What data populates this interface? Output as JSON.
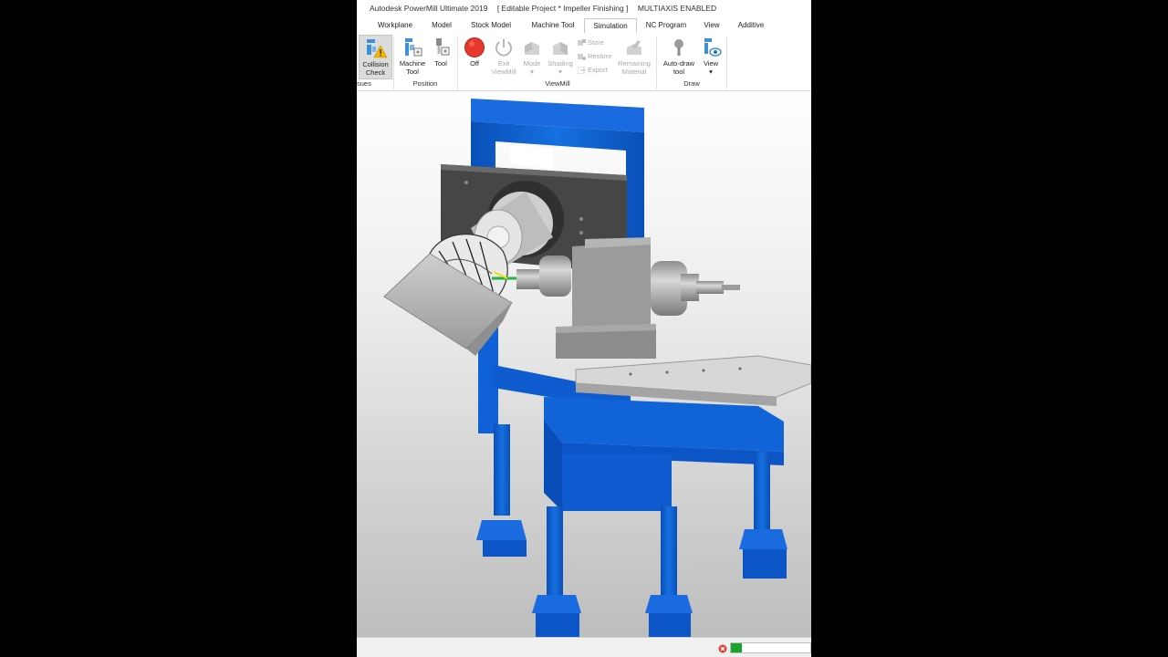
{
  "window": {
    "app_title": "Autodesk PowerMill Ultimate 2019",
    "project": "[ Editable Project * Impeller Finishing ]",
    "mode": "MULTIAXIS ENABLED"
  },
  "tabs": [
    {
      "label": "Workplane"
    },
    {
      "label": "Model"
    },
    {
      "label": "Stock Model"
    },
    {
      "label": "Machine Tool"
    },
    {
      "label": "Simulation"
    },
    {
      "label": "NC Program"
    },
    {
      "label": "View"
    },
    {
      "label": "Additive"
    }
  ],
  "active_tab": "Simulation",
  "ribbon": {
    "issues": {
      "label": "sues",
      "collision_check": {
        "line1": "Collision",
        "line2": "Check"
      }
    },
    "position": {
      "label": "Position",
      "machine_tool": {
        "line1": "Machine",
        "line2": "Tool"
      },
      "tool": {
        "line1": "Tool"
      }
    },
    "viewmill": {
      "label": "ViewMill",
      "off": {
        "line1": "Off"
      },
      "exit_viewmill": {
        "line1": "Exit",
        "line2": "ViewMill"
      },
      "mode": {
        "line1": "Mode",
        "arrow": "▾"
      },
      "shading": {
        "line1": "Shading",
        "arrow": "▾"
      },
      "store": "Store",
      "restore": "Restore",
      "export": "Export",
      "remaining_material": {
        "line1": "Remaining",
        "line2": "Material"
      }
    },
    "draw": {
      "label": "Draw",
      "auto_draw_tool": {
        "line1": "Auto-draw",
        "line2": "tool"
      },
      "view": {
        "line1": "View",
        "arrow": "▾"
      }
    }
  },
  "colors": {
    "machine_blue": "#0a5fd0",
    "viewmill_off_red": "#e8382c",
    "progress_green": "#16a52b",
    "accent": "#1e78c8"
  }
}
